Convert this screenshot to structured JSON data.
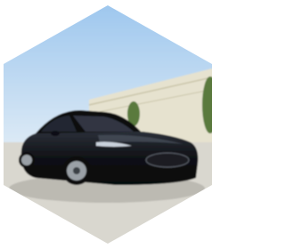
{
  "image": {
    "shape": "hexagon",
    "subject": "car-photo",
    "colors": {
      "page_background": "#ffffff",
      "sky_top": "#9cc6ee",
      "sky_bottom": "#dbe9f5",
      "building_wall": "#e6e2cf",
      "building_stripe": "#c9c4a8",
      "ground": "#d9d7cf",
      "tree": "#5a7a3c",
      "car_body": "#0f1115",
      "car_highlight": "#4b5260",
      "wheel_rim": "#9aa0a6"
    }
  }
}
